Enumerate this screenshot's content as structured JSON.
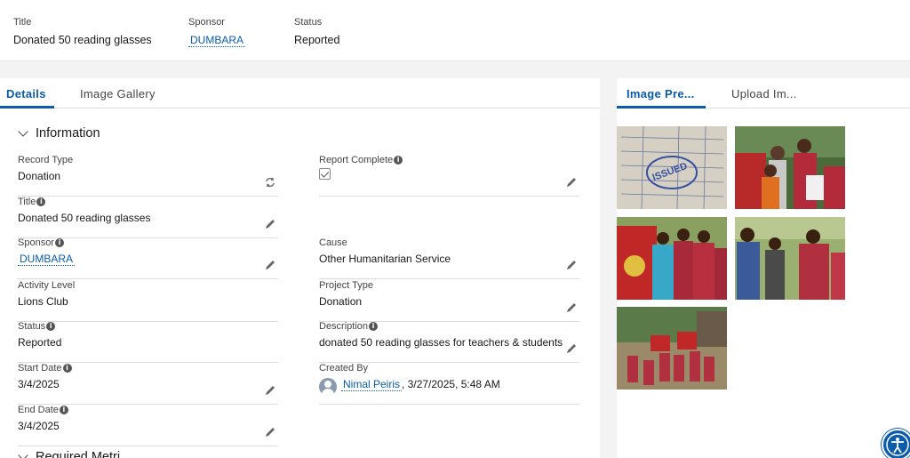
{
  "highlights": {
    "title_label": "Title",
    "title_value": "Donated 50 reading glasses",
    "sponsor_label": "Sponsor",
    "sponsor_value": "DUMBARA",
    "status_label": "Status",
    "status_value": "Reported"
  },
  "tabs": {
    "details": "Details",
    "gallery": "Image Gallery"
  },
  "section": {
    "information": "Information",
    "partial": "Required Metri..."
  },
  "fields": {
    "record_type": {
      "label": "Record Type",
      "value": "Donation"
    },
    "report_complete": {
      "label": "Report Complete",
      "checked": true
    },
    "title": {
      "label": "Title",
      "value": "Donated 50 reading glasses"
    },
    "sponsor": {
      "label": "Sponsor",
      "value": "DUMBARA"
    },
    "cause": {
      "label": "Cause",
      "value": "Other Humanitarian Service"
    },
    "activity_level": {
      "label": "Activity Level",
      "value": "Lions Club"
    },
    "project_type": {
      "label": "Project Type",
      "value": "Donation"
    },
    "status": {
      "label": "Status",
      "value": "Reported"
    },
    "description": {
      "label": "Description",
      "value": "donated 50 reading glasses for teachers & students"
    },
    "start_date": {
      "label": "Start Date",
      "value": "3/4/2025"
    },
    "created_by": {
      "label": "Created By",
      "user": "Nimal Peiris",
      "timestamp": ", 3/27/2025, 5:48 AM"
    },
    "end_date": {
      "label": "End Date",
      "value": "3/4/2025"
    }
  },
  "side_tabs": {
    "preview": "Image Pre...",
    "upload": "Upload Im..."
  },
  "gallery_images": [
    "document-photo",
    "people-photo",
    "banner-group-photo",
    "glasses-fitting-photo",
    "outdoor-group-photo"
  ],
  "colors": {
    "brand": "#0b5cab",
    "background": "#f3f3f3",
    "border": "#dcdcdc"
  },
  "icons": {
    "edit": "pencil-icon",
    "change_record_type": "refresh-icon",
    "info": "info-icon",
    "collapse": "chevron-down-icon",
    "accessibility": "accessibility-icon",
    "user": "avatar-icon"
  }
}
